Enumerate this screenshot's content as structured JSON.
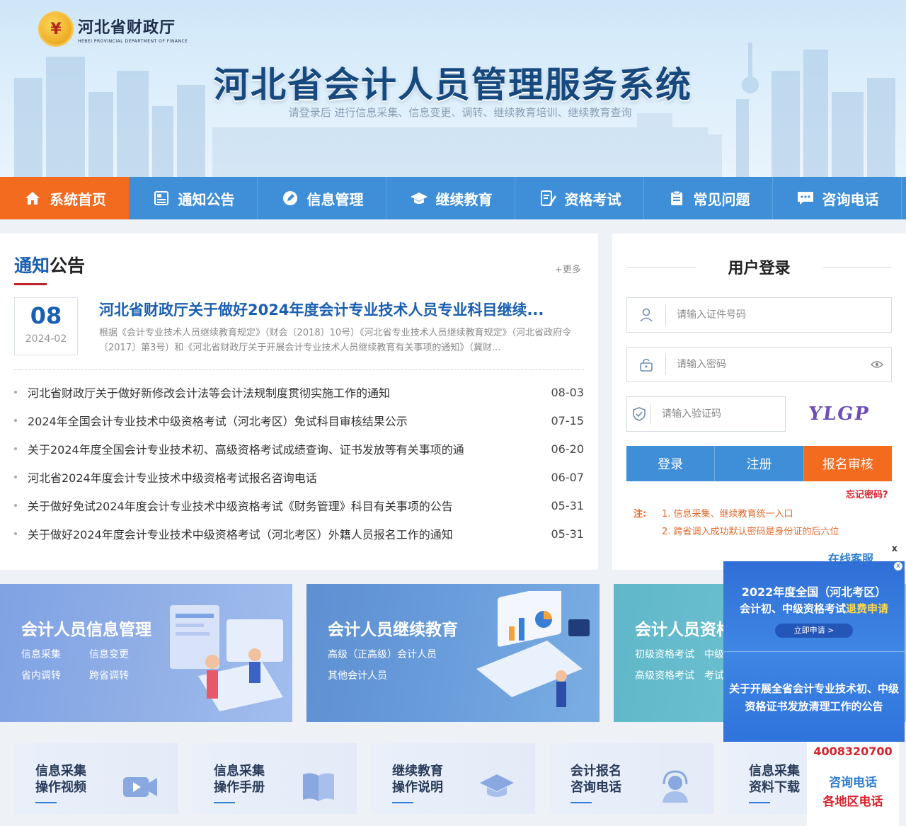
{
  "header": {
    "logo_badge": "¥",
    "logo_name": "河北省财政厅",
    "logo_en": "HEBEI PROVINCIAL DEPARTMENT OF FINANCE",
    "title": "河北省会计人员管理服务系统",
    "subtitle": "请登录后 进行信息采集、信息变更、调转、继续教育培训、继续教育查询"
  },
  "nav": {
    "items": [
      {
        "label": "系统首页",
        "icon": "home-icon"
      },
      {
        "label": "通知公告",
        "icon": "news-icon"
      },
      {
        "label": "信息管理",
        "icon": "edit-icon"
      },
      {
        "label": "继续教育",
        "icon": "graduation-cap-icon"
      },
      {
        "label": "资格考试",
        "icon": "exam-icon"
      },
      {
        "label": "常见问题",
        "icon": "clipboard-icon"
      },
      {
        "label": "咨询电话",
        "icon": "chat-icon"
      }
    ]
  },
  "notice": {
    "title_blue": "通知",
    "title_black": "公告",
    "more": "+更多",
    "featured": {
      "day": "08",
      "ym": "2024-02",
      "title": "河北省财政厅关于做好2024年度会计专业技术人员专业科目继续...",
      "desc": "根据《会计专业技术人员继续教育规定》（财会〔2018〕10号）《河北省专业技术人员继续教育规定》（河北省政府令〔2017〕第3号）和《河北省财政厅关于开展会计专业技术人员继续教育有关事项的通知》（冀财..."
    },
    "list": [
      {
        "title": "河北省财政厅关于做好新修改会计法等会计法规制度贯彻实施工作的通知",
        "date": "08-03"
      },
      {
        "title": "2024年全国会计专业技术中级资格考试（河北考区）免试科目审核结果公示",
        "date": "07-15"
      },
      {
        "title": "关于2024年度全国会计专业技术初、高级资格考试成绩查询、证书发放等有关事项的通",
        "date": "06-20"
      },
      {
        "title": "河北省2024年度会计专业技术中级资格考试报名咨询电话",
        "date": "06-07"
      },
      {
        "title": "关于做好免试2024年度会计专业技术中级资格考试《财务管理》科目有关事项的公告",
        "date": "05-31"
      },
      {
        "title": "关于做好2024年度会计专业技术中级资格考试（河北考区）外籍人员报名工作的通知",
        "date": "05-31"
      }
    ]
  },
  "login": {
    "title": "用户登录",
    "id_placeholder": "请输入证件号码",
    "password_placeholder": "请输入密码",
    "captcha_placeholder": "请输入验证码",
    "captcha_text": "YLGP",
    "login_btn": "登录",
    "register_btn": "注册",
    "review_btn": "报名审核",
    "forgot": "忘记密码?",
    "note_label": "注:",
    "notes": [
      "1. 信息采集、继续教育统一入口",
      "2. 跨省调入成功默认密码是身份证的后六位"
    ]
  },
  "banners": [
    {
      "title": "会计人员信息管理",
      "links": [
        "信息采集",
        "信息变更",
        "省内调转",
        "跨省调转"
      ]
    },
    {
      "title": "会计人员继续教育",
      "links": [
        "高级（正高级）会计人员",
        "其他会计人员"
      ]
    },
    {
      "title": "会计人员资格",
      "links": [
        "初级资格考试",
        "中级",
        "高级资格考试",
        "考试"
      ]
    }
  ],
  "cards": [
    {
      "line1": "信息采集",
      "line2": "操作视频",
      "icon": "video-icon"
    },
    {
      "line1": "信息采集",
      "line2": "操作手册",
      "icon": "book-icon"
    },
    {
      "line1": "继续教育",
      "line2": "操作说明",
      "icon": "graduation-cap-icon"
    },
    {
      "line1": "会计报名",
      "line2": "咨询电话",
      "icon": "headset-icon"
    },
    {
      "line1": "信息采集",
      "line2": "资料下载",
      "icon": "download-icon"
    }
  ],
  "float": {
    "kf_close": "x",
    "kf_title": "在线客服",
    "ad_close": "x",
    "ad_line1": "2022年度全国（河北考区）",
    "ad_line2_a": "会计初、中级资格考试",
    "ad_line2_b": "退费申请",
    "ad_btn": "立即申请 >",
    "ad_line3": "关于开展全省会计专业技术初、中级",
    "ad_line4": "资格证书发放清理工作的公告",
    "phone": "4008320700",
    "side1": "咨询电话",
    "side2": "各地区电话"
  },
  "colors": {
    "nav_blue": "#3f8fd8",
    "active_orange": "#f26b1f",
    "title_blue": "#17497e",
    "link_blue": "#1b5fb0",
    "alert_red": "#d4232b"
  }
}
